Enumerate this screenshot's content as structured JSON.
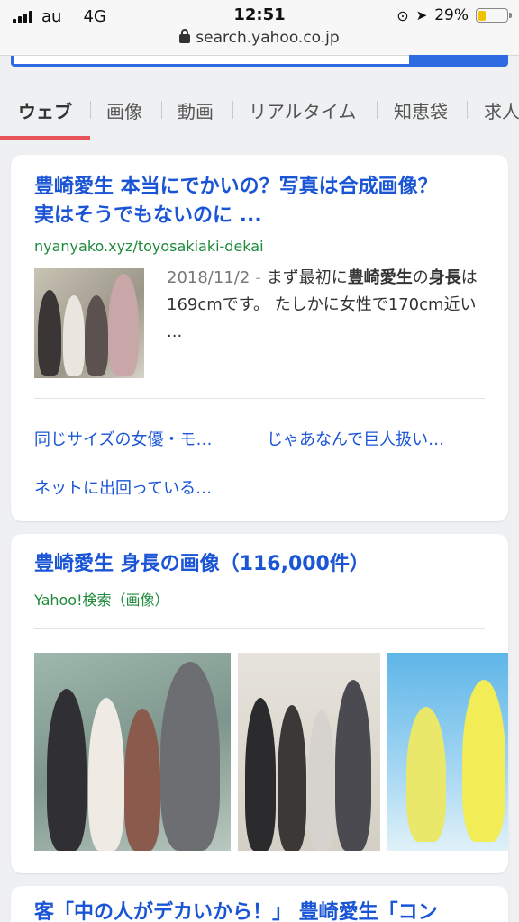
{
  "status_bar": {
    "carrier": "au",
    "network": "4G",
    "time": "12:51",
    "battery": "29%",
    "battery_level": 0.29,
    "battery_color": "#f2c200"
  },
  "browser": {
    "url": "search.yahoo.co.jp"
  },
  "tabs": [
    {
      "label": "ウェブ",
      "active": true
    },
    {
      "label": "画像",
      "active": false
    },
    {
      "label": "動画",
      "active": false
    },
    {
      "label": "リアルタイム",
      "active": false
    },
    {
      "label": "知恵袋",
      "active": false
    },
    {
      "label": "求人",
      "active": false
    }
  ],
  "result1": {
    "title_line1": "豊崎愛生 本当にでかいの？写真は合成画像？",
    "title_line2": "実はそうでもないのに ...",
    "url": "nyanyako.xyz/toyosakiaki-dekai",
    "date": "2018/11/2",
    "dash": "-",
    "snippet_pre": "まず最初に",
    "snippet_bold1": "豊崎愛生",
    "snippet_mid": "の",
    "snippet_bold2": "身長",
    "snippet_post": "は169cmです。 たしかに女性で170cm近い ...",
    "sitelinks": [
      "同じサイズの女優・モ…",
      "じゃあなんで巨人扱い…",
      "ネットに出回っている…"
    ]
  },
  "result2": {
    "title": "豊崎愛生 身長の画像（116,000件）",
    "source": "Yahoo!検索（画像）"
  },
  "result3": {
    "title_partial": "客「中の人がデカいから！」 豊崎愛生「コン"
  },
  "colors": {
    "link": "#1a55d6",
    "url_green": "#1f8a3c",
    "tab_accent": "#e8525a",
    "search_blue": "#2f6be0"
  }
}
